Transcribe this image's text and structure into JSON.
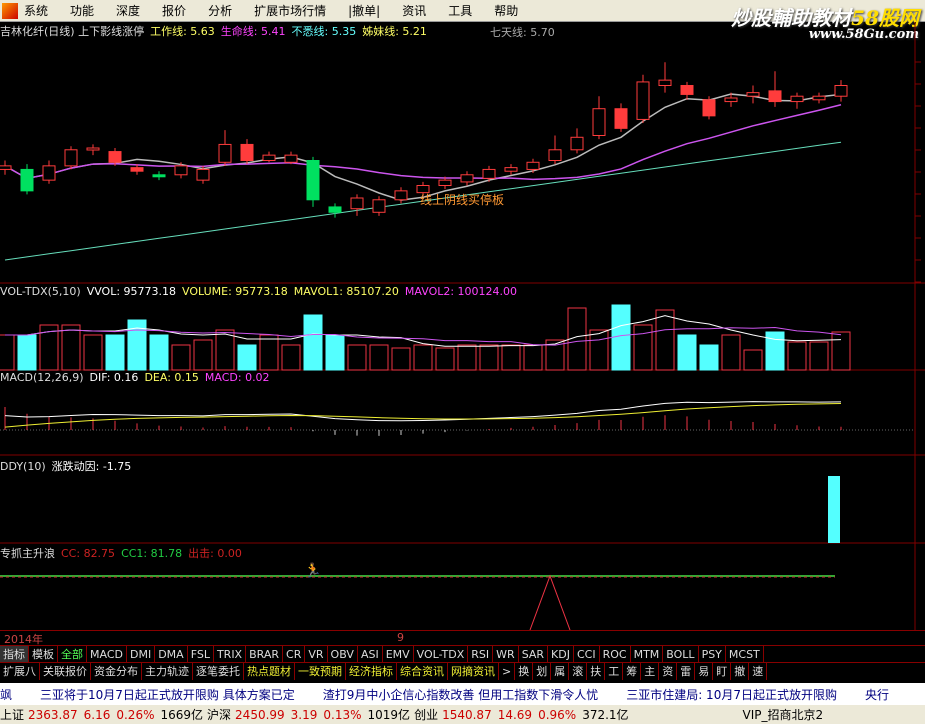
{
  "menu": [
    "系统",
    "功能",
    "深度",
    "报价",
    "分析",
    "扩展市场行情",
    "|撤单|",
    "资讯",
    "工具",
    "帮助"
  ],
  "brand": {
    "name": "炒股輔助教材",
    "highlight": "58股网",
    "url_text": "www.58Gu.com"
  },
  "price_header": {
    "title": "吉林化纤(日线) 上下影线涨停",
    "items": [
      {
        "label": "工作线: 5.63",
        "color": "#ffff66"
      },
      {
        "label": "生命线: 5.41",
        "color": "#ff44ff"
      },
      {
        "label": "不悉线: 5.35",
        "color": "#66ffff"
      },
      {
        "label": "姊妹线: 5.21",
        "color": "#ffff66"
      }
    ],
    "extra": "七天线: 5.70"
  },
  "annotation": "线上阴线买停板",
  "colors": {
    "up": "#ff3c3c",
    "down": "#00e060",
    "cyan": "#54ffff",
    "grid": "#800000"
  },
  "candles": [
    [
      5.23,
      5.25,
      5.28,
      5.2,
      "u"
    ],
    [
      5.23,
      5.11,
      5.26,
      5.09,
      "d"
    ],
    [
      5.17,
      5.25,
      5.28,
      5.15,
      "u"
    ],
    [
      5.25,
      5.34,
      5.36,
      5.23,
      "u"
    ],
    [
      5.34,
      5.35,
      5.37,
      5.31,
      "u"
    ],
    [
      5.33,
      5.27,
      5.35,
      5.25,
      "r"
    ],
    [
      5.24,
      5.22,
      5.26,
      5.2,
      "r"
    ],
    [
      5.19,
      5.2,
      5.22,
      5.17,
      "d"
    ],
    [
      5.2,
      5.25,
      5.27,
      5.18,
      "u"
    ],
    [
      5.17,
      5.23,
      5.25,
      5.15,
      "u"
    ],
    [
      5.27,
      5.37,
      5.45,
      5.25,
      "u"
    ],
    [
      5.37,
      5.28,
      5.4,
      5.26,
      "r"
    ],
    [
      5.28,
      5.31,
      5.33,
      5.27,
      "u"
    ],
    [
      5.27,
      5.31,
      5.33,
      5.26,
      "u"
    ],
    [
      5.28,
      5.06,
      5.3,
      5.02,
      "d"
    ],
    [
      5.02,
      4.99,
      5.04,
      4.96,
      "d"
    ],
    [
      5.01,
      5.07,
      5.09,
      4.97,
      "u"
    ],
    [
      4.99,
      5.06,
      5.08,
      4.97,
      "u"
    ],
    [
      5.06,
      5.11,
      5.13,
      5.04,
      "u"
    ],
    [
      5.1,
      5.14,
      5.16,
      5.08,
      "u"
    ],
    [
      5.14,
      5.17,
      5.19,
      5.12,
      "u"
    ],
    [
      5.16,
      5.2,
      5.22,
      5.14,
      "u"
    ],
    [
      5.18,
      5.23,
      5.25,
      5.16,
      "u"
    ],
    [
      5.22,
      5.24,
      5.26,
      5.2,
      "u"
    ],
    [
      5.23,
      5.27,
      5.29,
      5.21,
      "u"
    ],
    [
      5.28,
      5.34,
      5.42,
      5.26,
      "u"
    ],
    [
      5.34,
      5.41,
      5.46,
      5.32,
      "u"
    ],
    [
      5.42,
      5.57,
      5.64,
      5.4,
      "u"
    ],
    [
      5.57,
      5.46,
      5.6,
      5.44,
      "r"
    ],
    [
      5.51,
      5.72,
      5.76,
      5.49,
      "u"
    ],
    [
      5.7,
      5.73,
      5.83,
      5.66,
      "u"
    ],
    [
      5.7,
      5.65,
      5.72,
      5.62,
      "r"
    ],
    [
      5.62,
      5.53,
      5.64,
      5.51,
      "r"
    ],
    [
      5.61,
      5.63,
      5.66,
      5.58,
      "u"
    ],
    [
      5.64,
      5.66,
      5.7,
      5.6,
      "u"
    ],
    [
      5.67,
      5.61,
      5.78,
      5.58,
      "r"
    ],
    [
      5.61,
      5.64,
      5.66,
      5.57,
      "u"
    ],
    [
      5.62,
      5.64,
      5.66,
      5.6,
      "u"
    ],
    [
      5.64,
      5.7,
      5.73,
      5.61,
      "u"
    ]
  ],
  "volume_header": {
    "title": "VOL-TDX(5,10)",
    "items": [
      {
        "label": "VVOL: 95773.18",
        "color": "#ffffff"
      },
      {
        "label": "VOLUME: 95773.18",
        "color": "#ffff66"
      },
      {
        "label": "MAVOL1: 85107.20",
        "color": "#ffff66"
      },
      {
        "label": "MAVOL2: 100124.00",
        "color": "#ff44ff"
      }
    ]
  },
  "volumes": [
    87500,
    87500,
    112500,
    112500,
    87500,
    87500,
    125000,
    87500,
    62500,
    75000,
    100000,
    62500,
    87500,
    62500,
    137500,
    87500,
    62500,
    62500,
    55000,
    62500,
    55000,
    62500,
    62500,
    62500,
    62500,
    75000,
    155000,
    100000,
    162500,
    112500,
    150000,
    87500,
    62500,
    87500,
    50000,
    95000,
    70000,
    70000,
    95000
  ],
  "macd_header": {
    "title": "MACD(12,26,9)",
    "items": [
      {
        "label": "DIF: 0.16",
        "color": "#ffffff"
      },
      {
        "label": "DEA: 0.15",
        "color": "#ffff66"
      },
      {
        "label": "MACD: 0.02",
        "color": "#ff44ff"
      }
    ]
  },
  "ddy_header": {
    "title": "DDY(10)",
    "items": [
      {
        "label": "涨跌动因: -1.75",
        "color": "#ffffff"
      }
    ]
  },
  "last_header": {
    "title": "专抓主升浪",
    "items": [
      {
        "label": "CC: 82.75",
        "color": "#cc2222"
      },
      {
        "label": "CC1: 81.78",
        "color": "#22cc44"
      },
      {
        "label": "出击: 0.00",
        "color": "#cc2222"
      }
    ]
  },
  "dates": {
    "year": "2014年",
    "month": "9"
  },
  "tabs1": [
    "指标",
    "模板",
    "全部",
    "MACD",
    "DMI",
    "DMA",
    "FSL",
    "TRIX",
    "BRAR",
    "CR",
    "VR",
    "OBV",
    "ASI",
    "EMV",
    "VOL-TDX",
    "RSI",
    "WR",
    "SAR",
    "KDJ",
    "CCI",
    "ROC",
    "MTM",
    "BOLL",
    "PSY",
    "MCST"
  ],
  "tabs2": [
    "扩展八",
    "关联报价",
    "资金分布",
    "主力轨迹",
    "逐笔委托",
    "热点题材",
    "一致预期",
    "经济指标",
    "综合资讯",
    "网摘资讯",
    ">",
    "换",
    "划",
    "属",
    "滚",
    "扶",
    "工",
    "筹",
    "主",
    "资",
    "雷",
    "易",
    "盯",
    "撤",
    "速"
  ],
  "news": [
    "飒",
    "三亚将于10月7日起正式放开限购 具体方案已定",
    "渣打9月中小企信心指数改善 但用工指数下滑令人忧",
    "三亚市住建局: 10月7日起正式放开限购",
    "央行"
  ],
  "status": [
    {
      "name": "上证",
      "price": "2363.87",
      "chg": "6.16",
      "pct": "0.26%",
      "amt": "1669亿"
    },
    {
      "name": "沪深",
      "price": "2450.99",
      "chg": "3.19",
      "pct": "0.13%",
      "amt": "1019亿"
    },
    {
      "name": "创业",
      "price": "1540.87",
      "chg": "14.69",
      "pct": "0.96%",
      "amt": "372.1亿"
    }
  ],
  "server": "VIP_招商北京2"
}
